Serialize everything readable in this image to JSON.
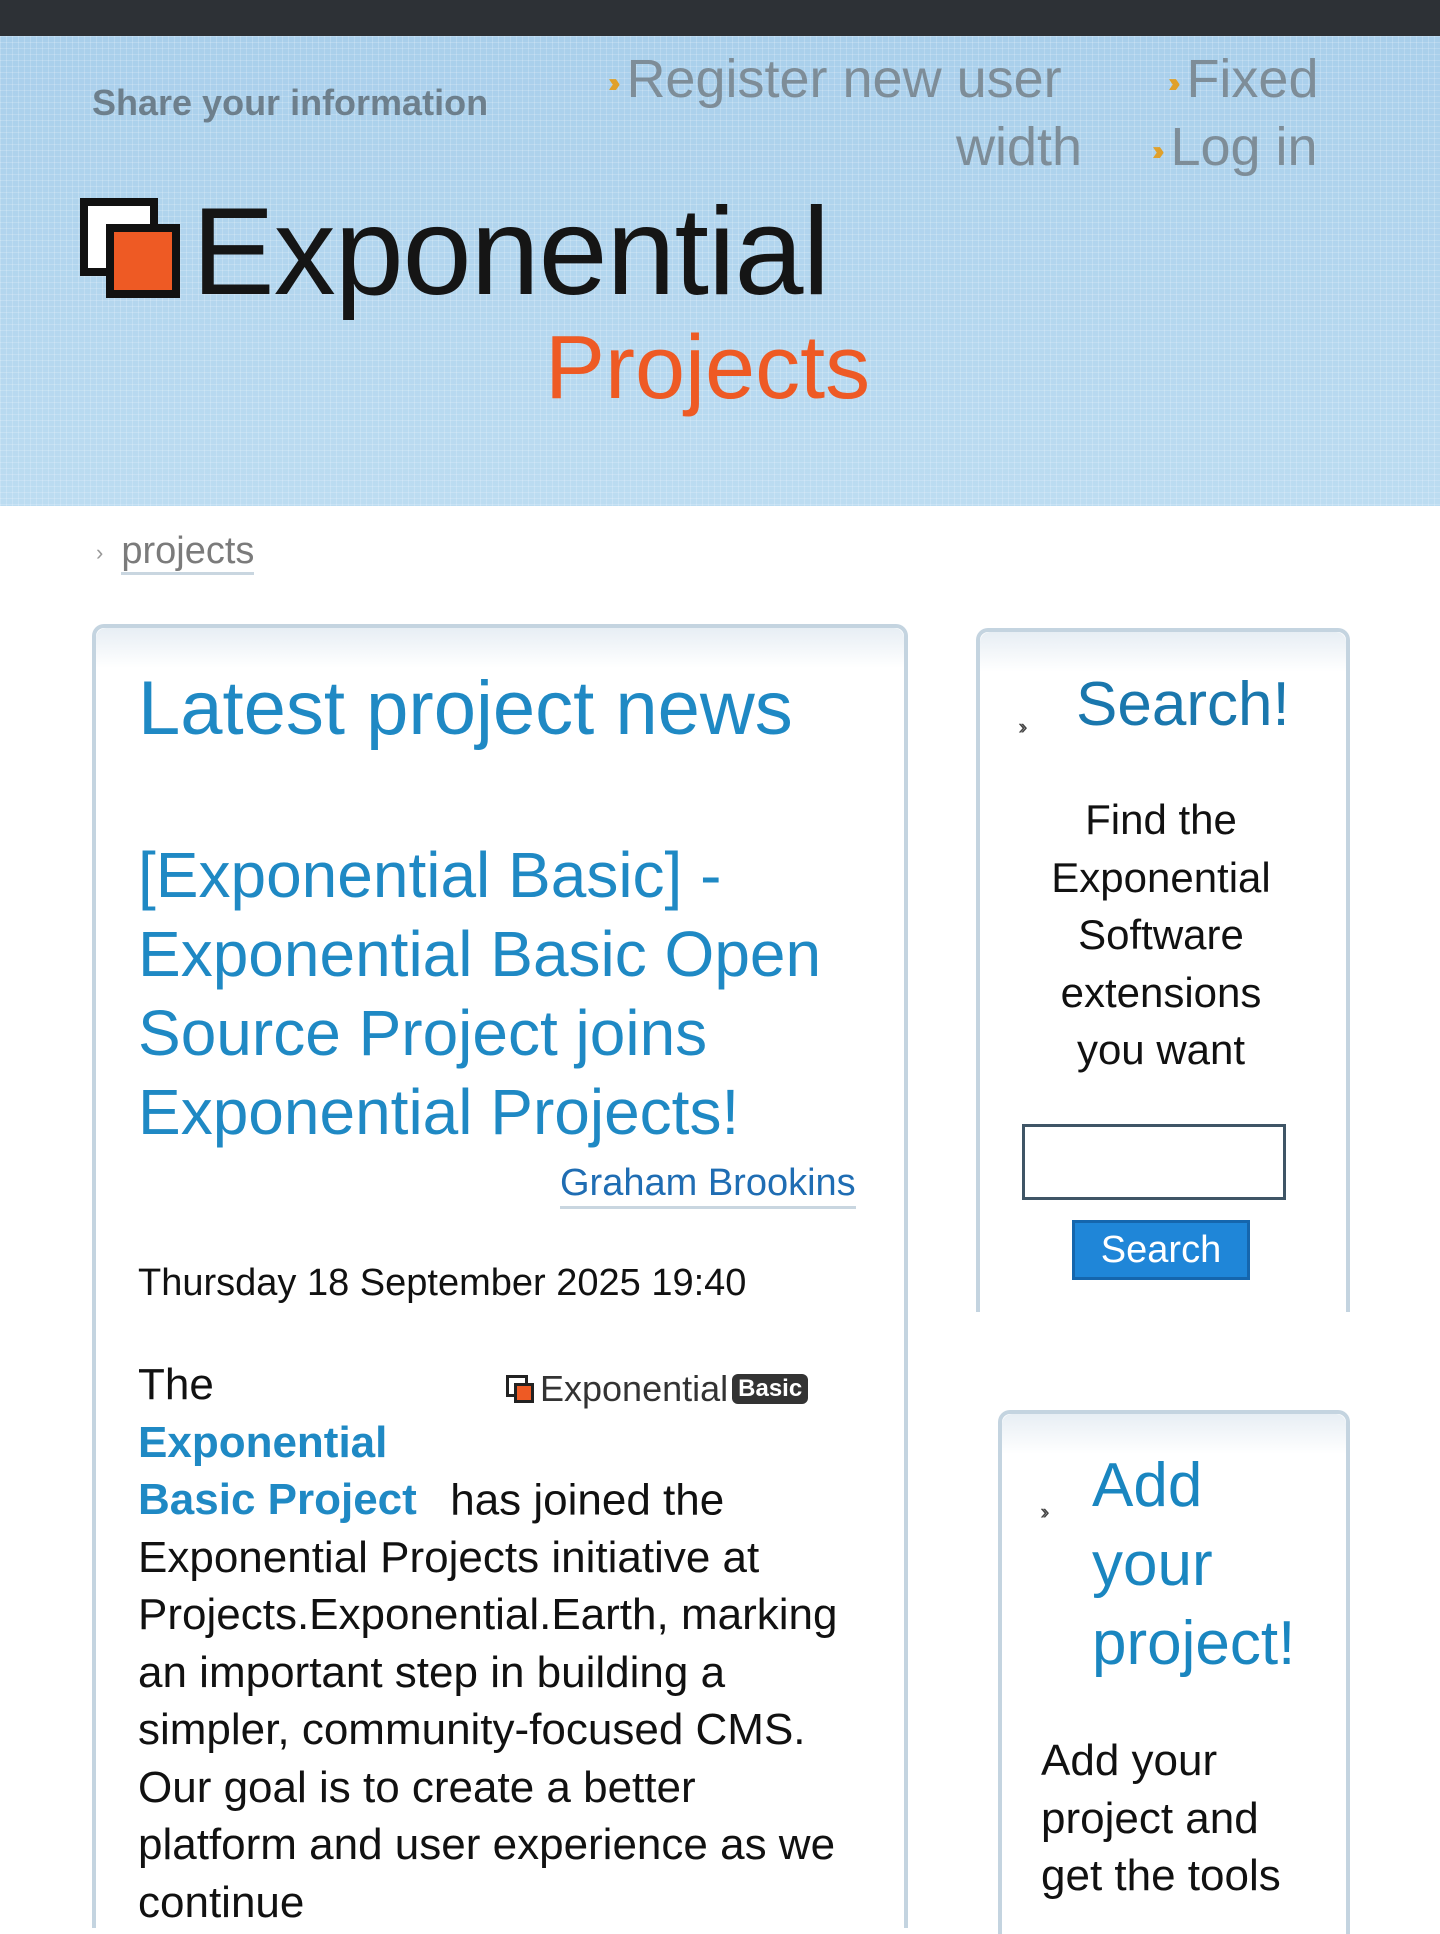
{
  "header": {
    "share_text": "Share your information",
    "nav": {
      "register_line1": "Register new user",
      "register_line2": "width",
      "fixed_label": "Fixed",
      "login_label": "Log in"
    },
    "logo_word": "Exponential",
    "logo_sub": "Projects"
  },
  "breadcrumb": {
    "label": "projects"
  },
  "main": {
    "heading": "Latest project news",
    "article": {
      "title": "[Exponential Basic] - Exponential Basic Open Source Project joins Exponential Projects!",
      "author": "Graham Brookins",
      "date": "Thursday 18 September 2025 19:40",
      "body_intro": "The",
      "body_link": "Exponential Basic Project",
      "body_rest": " has joined the Exponential Projects initiative at Projects.Exponential.Earth, marking an important step in building a simpler, community-focused CMS. Our goal is to create a better platform and user experience as we continue",
      "image_logo_word": "Exponential",
      "image_logo_badge": "Basic"
    }
  },
  "sidebar": {
    "search": {
      "title": "Search!",
      "description": "Find the Exponential Software extensions you want",
      "input_value": "",
      "button_label": "Search"
    },
    "add_project": {
      "title": "Add your project!",
      "description": "Add your project and get the tools"
    }
  },
  "colors": {
    "accent_blue": "#1f89c4",
    "brand_orange": "#ee5a24",
    "header_bg": "#b2d6ef",
    "top_bar": "#2d3136"
  }
}
